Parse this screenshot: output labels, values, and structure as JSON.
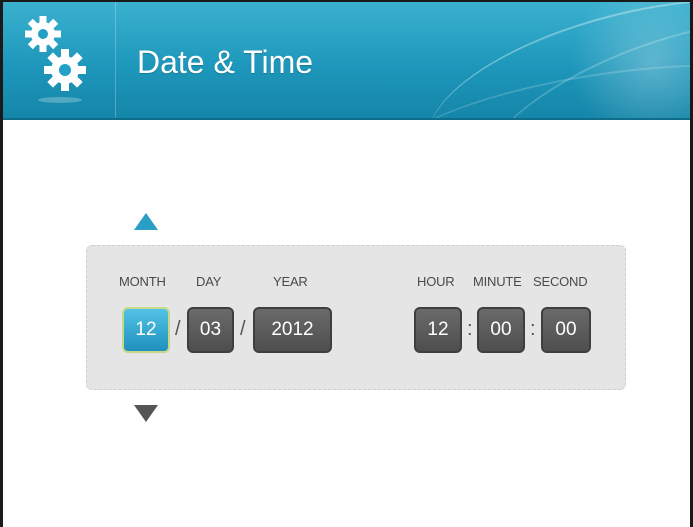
{
  "header": {
    "title": "Date & Time",
    "icon": "gears-icon"
  },
  "colors": {
    "header": "#1d97bb",
    "active_field": "#2a9ec4",
    "field": "#555555",
    "panel": "#e5e5e5"
  },
  "controls": {
    "increment_icon": "triangle-up",
    "decrement_icon": "triangle-down"
  },
  "date": {
    "month_label": "MONTH",
    "month_value": "12",
    "day_label": "DAY",
    "day_value": "03",
    "year_label": "YEAR",
    "year_value": "2012",
    "separator": "/"
  },
  "time": {
    "hour_label": "HOUR",
    "hour_value": "12",
    "minute_label": "MINUTE",
    "minute_value": "00",
    "second_label": "SECOND",
    "second_value": "00",
    "separator": ":"
  },
  "selected_field": "month"
}
